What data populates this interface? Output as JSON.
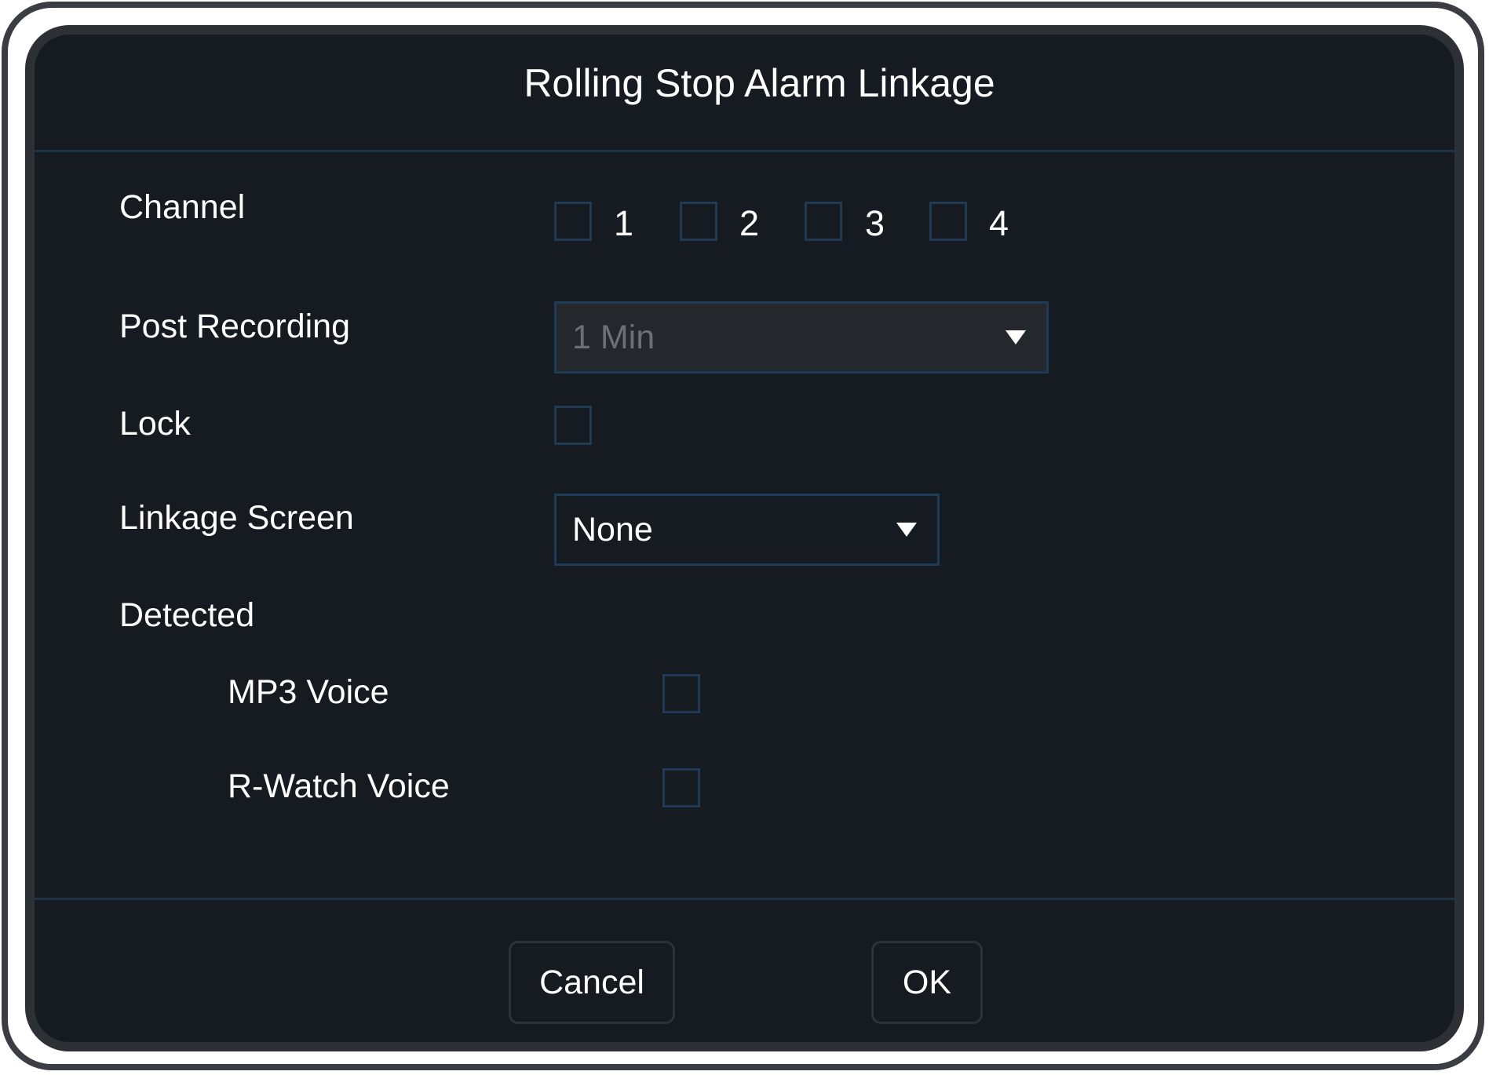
{
  "dialog": {
    "title": "Rolling Stop Alarm Linkage"
  },
  "channel": {
    "label": "Channel",
    "options": [
      {
        "label": "1",
        "checked": false
      },
      {
        "label": "2",
        "checked": false
      },
      {
        "label": "3",
        "checked": false
      },
      {
        "label": "4",
        "checked": false
      }
    ]
  },
  "post_recording": {
    "label": "Post Recording",
    "value": "1 Min",
    "disabled": true
  },
  "lock": {
    "label": "Lock",
    "checked": false
  },
  "linkage_screen": {
    "label": "Linkage Screen",
    "value": "None"
  },
  "detected": {
    "label": "Detected",
    "mp3_voice": {
      "label": "MP3 Voice",
      "checked": false
    },
    "rwatch_voice": {
      "label": "R-Watch Voice",
      "checked": false
    }
  },
  "buttons": {
    "cancel": "Cancel",
    "ok": "OK"
  },
  "colors": {
    "dialog_bg": "#161b22",
    "divider": "#1e3346",
    "checkbox_border": "#1f3a52",
    "text": "#ffffff"
  },
  "icons": {
    "dropdown": "chevron-down-icon"
  }
}
